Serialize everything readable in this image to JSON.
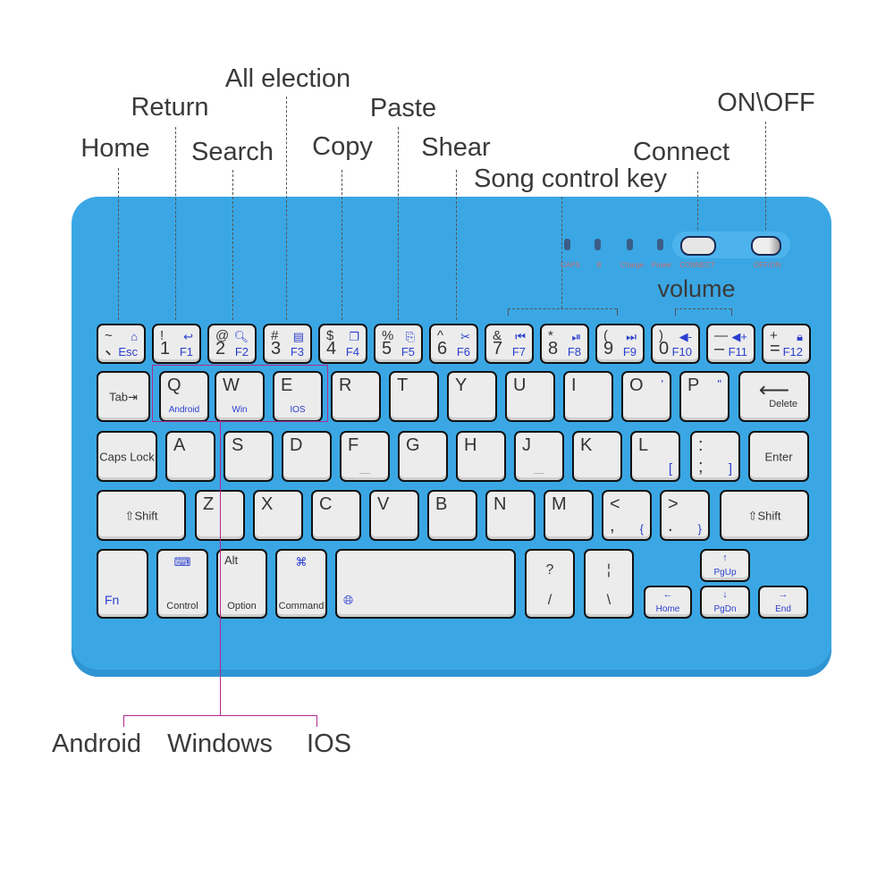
{
  "annotations": {
    "home": "Home",
    "return": "Return",
    "all_election": "All election",
    "search": "Search",
    "copy": "Copy",
    "paste": "Paste",
    "shear": "Shear",
    "song_control": "Song control key",
    "connect": "Connect",
    "on_off": "ON\\OFF",
    "volume": "volume"
  },
  "os_labels": {
    "android": "Android",
    "windows": "Windows",
    "ios": "IOS"
  },
  "indicators": [
    "CAPS",
    "B",
    "Charge",
    "Power"
  ],
  "switch_labels": {
    "connect": "CONNECT",
    "power": "OFF/ON"
  },
  "colors": {
    "body": "#3aa7e4",
    "key": "#ececec",
    "key_text": "#333333",
    "fn_text": "#2b3fcf",
    "os_box": "#b0298f"
  },
  "rows": [
    [
      {
        "tl": "~",
        "bl": "、",
        "tr": "⌂",
        "br": "Esc",
        "icon": "home-icon"
      },
      {
        "tl": "!",
        "bl": "1",
        "tr": "↩",
        "br": "F1",
        "icon": "return-icon"
      },
      {
        "tl": "@",
        "bl": "2",
        "tr": "🔍︎",
        "br": "F2",
        "icon": "search-icon"
      },
      {
        "tl": "#",
        "bl": "3",
        "tr": "▤",
        "br": "F3",
        "icon": "select-all-icon"
      },
      {
        "tl": "$",
        "bl": "4",
        "tr": "❐",
        "br": "F4",
        "icon": "copy-icon"
      },
      {
        "tl": "%",
        "bl": "5",
        "tr": "⎘",
        "br": "F5",
        "icon": "paste-icon"
      },
      {
        "tl": "^",
        "bl": "6",
        "tr": "✂",
        "br": "F6",
        "icon": "cut-icon"
      },
      {
        "tl": "&",
        "bl": "7",
        "tr": "⏮",
        "br": "F7",
        "icon": "previous-track-icon"
      },
      {
        "tl": "*",
        "bl": "8",
        "tr": "⏯",
        "br": "F8",
        "icon": "play-pause-icon"
      },
      {
        "tl": "(",
        "bl": "9",
        "tr": "⏭",
        "br": "F9",
        "icon": "next-track-icon"
      },
      {
        "tl": ")",
        "bl": "0",
        "tr": "◀-",
        "br": "F10",
        "icon": "volume-down-icon"
      },
      {
        "tl": "—",
        "bl": "–",
        "tr": "◀+",
        "br": "F11",
        "icon": "volume-up-icon"
      },
      {
        "tl": "+",
        "bl": "=",
        "tr": "🔒︎",
        "br": "F12",
        "icon": "lock-icon"
      }
    ],
    [
      {
        "cc": "Tab⇥"
      },
      {
        "tl": "Q",
        "bc": "Android"
      },
      {
        "tl": "W",
        "bc": "Win"
      },
      {
        "tl": "E",
        "bc": "IOS"
      },
      {
        "tl": "R"
      },
      {
        "tl": "T"
      },
      {
        "tl": "Y"
      },
      {
        "tl": "U"
      },
      {
        "tl": "I"
      },
      {
        "tl": "O",
        "tr": "'"
      },
      {
        "tl": "P",
        "tr": "\""
      },
      {
        "ct": "⟵",
        "br": "Delete",
        "icon": "backspace-arrow-icon"
      }
    ],
    [
      {
        "cc": "Caps Lock"
      },
      {
        "tl": "A"
      },
      {
        "tl": "S"
      },
      {
        "tl": "D"
      },
      {
        "tl": "F",
        "bump": true
      },
      {
        "tl": "G"
      },
      {
        "tl": "H"
      },
      {
        "tl": "J",
        "bump": true
      },
      {
        "tl": "K"
      },
      {
        "tl": "L",
        "br": "["
      },
      {
        "tl": ":",
        "bl": ";",
        "br": "]"
      },
      {
        "cc": "Enter"
      }
    ],
    [
      {
        "cc": "⇧Shift"
      },
      {
        "tl": "Z"
      },
      {
        "tl": "X"
      },
      {
        "tl": "C"
      },
      {
        "tl": "V"
      },
      {
        "tl": "B"
      },
      {
        "tl": "N"
      },
      {
        "tl": "M"
      },
      {
        "tl": "<",
        "bl": ",",
        "br": "{"
      },
      {
        "tl": ">",
        "bl": ".",
        "br": "}"
      },
      {
        "cc": "⇧Shift"
      }
    ],
    [
      {
        "bl": "Fn",
        "blue_bl": true
      },
      {
        "ct": "⌨",
        "cb": "Control",
        "icon": "keyboard-icon"
      },
      {
        "tl": "Alt",
        "cb": "Option"
      },
      {
        "ct": "⌘",
        "cb": "Command",
        "icon": "command-icon"
      },
      {
        "bl": "🌐︎",
        "blue_bl": true,
        "icon": "globe-icon"
      },
      {
        "tl": "?",
        "cb": "/"
      },
      {
        "tl": "¦",
        "cb": "\\"
      },
      {
        "ct": "←",
        "cb": "Home",
        "icon": "arrow-left-icon"
      },
      {
        "ct": "↑",
        "cb": "PgUp",
        "icon": "arrow-up-icon"
      },
      {
        "ct": "↓",
        "cb": "PgDn",
        "icon": "arrow-down-icon"
      },
      {
        "ct": "→",
        "cb": "End",
        "icon": "arrow-right-icon"
      }
    ]
  ]
}
